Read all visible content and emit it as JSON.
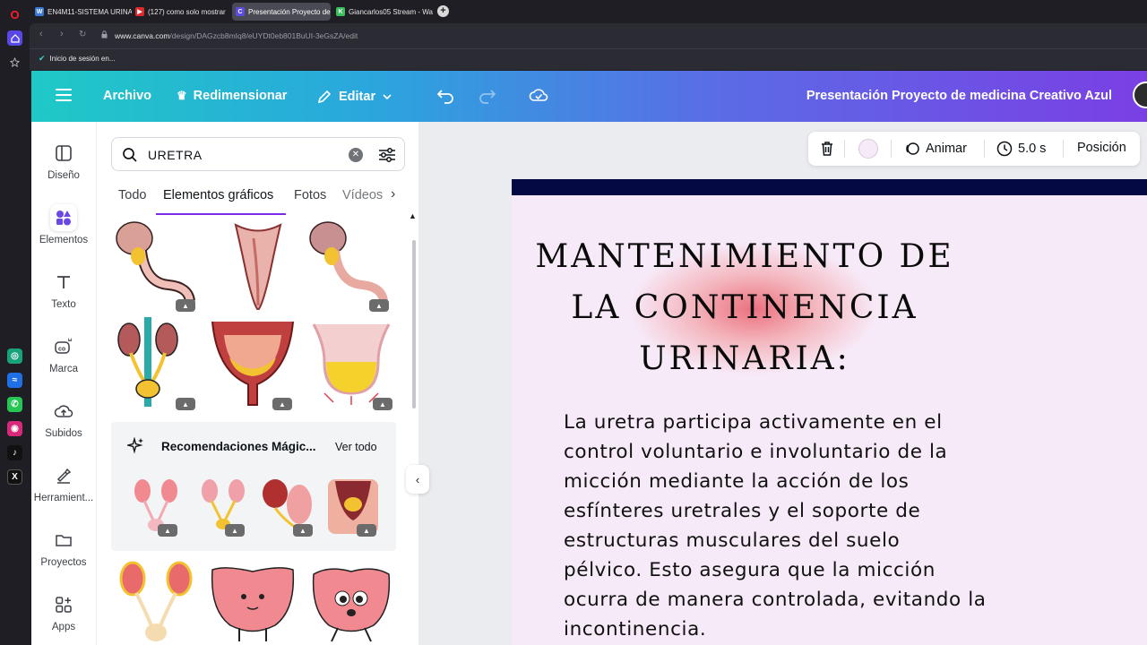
{
  "browser": {
    "tabs": [
      {
        "label": "EN4M11-SISTEMA URINA",
        "favicon": "W",
        "favicon_color": "#3b79d6"
      },
      {
        "label": "(127) como solo mostrar",
        "favicon": "▶",
        "favicon_color": "#e02a2a"
      },
      {
        "label": "Presentación Proyecto de",
        "favicon": "C",
        "favicon_color": "#5d4be6"
      },
      {
        "label": "Giancarlos05 Stream - Wa",
        "favicon": "K",
        "favicon_color": "#39c05a"
      }
    ],
    "url_domain": "www.canva.com",
    "url_path": "/design/DAGzcb8mIq8/eUYDt0eb801BuUI-3eGsZA/edit",
    "bookmark": "Inicio de sesión en..."
  },
  "header": {
    "archivo": "Archivo",
    "redimensionar": "Redimensionar",
    "editar": "Editar",
    "title": "Presentación Proyecto de medicina Creativo Azul"
  },
  "sidenav": [
    {
      "label": "Diseño",
      "icon": "layout-icon"
    },
    {
      "label": "Elementos",
      "icon": "shapes-icon"
    },
    {
      "label": "Texto",
      "icon": "text-icon"
    },
    {
      "label": "Marca",
      "icon": "brand-icon"
    },
    {
      "label": "Subidos",
      "icon": "upload-icon"
    },
    {
      "label": "Herramient...",
      "icon": "tools-icon"
    },
    {
      "label": "Proyectos",
      "icon": "folder-icon"
    },
    {
      "label": "Apps",
      "icon": "apps-icon"
    }
  ],
  "panel": {
    "search_value": "URETRA",
    "tabs": [
      "Todo",
      "Elementos gráficos",
      "Fotos",
      "Vídeos"
    ],
    "rec_title": "Recomendaciones Mágic...",
    "rec_all": "Ver todo"
  },
  "toolbar": {
    "animar": "Animar",
    "duration": "5.0 s",
    "posicion": "Posición"
  },
  "slide": {
    "heading_line1": "MANTENIMIENTO DE",
    "heading_line2": "LA CONTINENCIA",
    "heading_line3": "URINARIA:",
    "body_line1": "La uretra participa activamente en el",
    "body_line2": "control voluntario e involuntario de la",
    "body_line3": "micción mediante la acción de los",
    "body_line4": "esfínteres uretrales y el soporte de",
    "body_line5": "estructuras musculares del suelo",
    "body_line6": "pélvico. Esto asegura que la micción",
    "body_line7": "ocurra de manera controlada, evitando la",
    "body_line8": "incontinencia."
  },
  "colors": {
    "accent": "#7d2ae8",
    "slide_bg": "#f7eaf8",
    "slide_bar": "#040843"
  }
}
